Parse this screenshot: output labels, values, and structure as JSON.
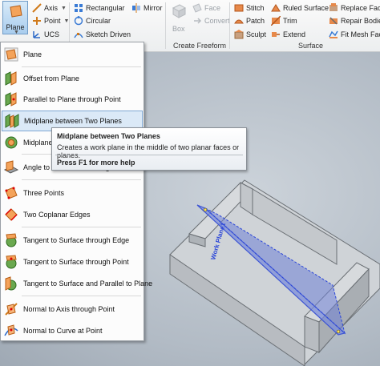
{
  "ribbon": {
    "plane_button": {
      "label": "Plane",
      "icon": "plane-icon"
    },
    "work_features": [
      {
        "label": "Axis",
        "icon": "axis-icon",
        "dropdown": true
      },
      {
        "label": "Point",
        "icon": "point-icon",
        "dropdown": true
      },
      {
        "label": "UCS",
        "icon": "ucs-icon",
        "dropdown": false
      }
    ],
    "sketch": [
      {
        "label": "Rectangular",
        "icon": "rectangular-pattern-icon"
      },
      {
        "label": "Circular",
        "icon": "circular-pattern-icon"
      },
      {
        "label": "Sketch Driven",
        "icon": "sketch-driven-pattern-icon"
      }
    ],
    "mirror": {
      "label": "Mirror",
      "icon": "mirror-icon"
    },
    "freeform": {
      "box_label": "Box",
      "face_label": "Face",
      "convert_label": "Convert",
      "group_label": "Create Freeform"
    },
    "surface": {
      "col1": [
        "Stitch",
        "Patch",
        "Sculpt"
      ],
      "col2": [
        "Ruled Surface",
        "Trim",
        "Extend"
      ],
      "col3": [
        "Replace Face",
        "Repair Bodies",
        "Fit Mesh Face"
      ],
      "group_label": "Surface"
    }
  },
  "menu": {
    "items": [
      {
        "label": "Plane",
        "icon": "plane-icon"
      },
      {
        "label": "Offset from Plane",
        "icon": "offset-plane-icon"
      },
      {
        "label": "Parallel to Plane through Point",
        "icon": "parallel-plane-point-icon"
      },
      {
        "label": "Midplane between Two Planes",
        "icon": "midplane-icon",
        "highlighted": true
      },
      {
        "label": "Midplane",
        "icon": "midplane-torus-icon"
      },
      {
        "label": "Angle to Plane around Edge",
        "icon": "angle-plane-icon"
      },
      {
        "label": "Three Points",
        "icon": "three-points-icon"
      },
      {
        "label": "Two Coplanar Edges",
        "icon": "coplanar-edges-icon"
      },
      {
        "label": "Tangent to Surface through Edge",
        "icon": "tangent-edge-icon"
      },
      {
        "label": "Tangent to Surface through Point",
        "icon": "tangent-point-icon"
      },
      {
        "label": "Tangent to Surface and Parallel to Plane",
        "icon": "tangent-parallel-icon"
      },
      {
        "label": "Normal to Axis through Point",
        "icon": "normal-axis-icon"
      },
      {
        "label": "Normal to Curve at Point",
        "icon": "normal-curve-icon"
      }
    ]
  },
  "tooltip": {
    "title": "Midplane between Two Planes",
    "description": "Creates a work plane in the middle of two planar faces or planes.",
    "help": "Press F1 for more help"
  },
  "viewport": {
    "plane_label": "Work Plane1",
    "colors": {
      "model_face": "#c9cdd1",
      "work_plane": "#5a6fd0",
      "highlight": "#2a45d8"
    }
  }
}
